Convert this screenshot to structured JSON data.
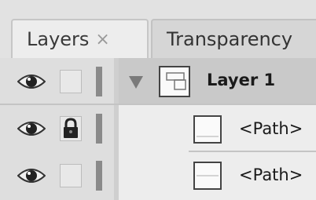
{
  "tabs": [
    {
      "label": "Layers",
      "close_glyph": "×",
      "active": true
    },
    {
      "label": "Transparency",
      "active": false
    }
  ],
  "layers": [
    {
      "name": "Layer 1",
      "visible": true,
      "locked": false,
      "expanded": true,
      "icon": "layer-thumbnail-icon"
    },
    {
      "name": "<Path>",
      "visible": true,
      "locked": true,
      "icon": "path-thumbnail-icon"
    },
    {
      "name": "<Path>",
      "visible": true,
      "locked": false,
      "icon": "path-thumbnail-icon"
    }
  ],
  "icons": {
    "visibility": "eye-icon",
    "lock": "lock-icon",
    "disclosure": "disclosure-triangle-icon"
  },
  "colors": {
    "selected_row": "#c9c9c9",
    "panel_bg": "#ededed"
  }
}
